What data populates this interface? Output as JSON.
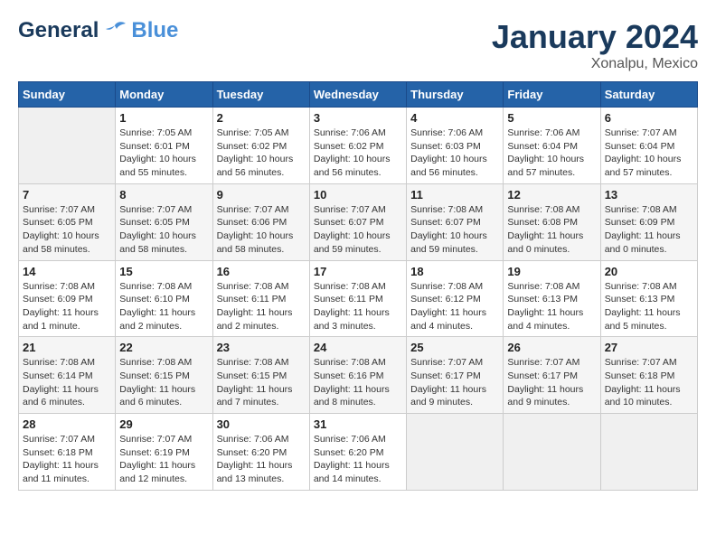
{
  "header": {
    "logo_general": "General",
    "logo_blue": "Blue",
    "month_title": "January 2024",
    "location": "Xonalpu, Mexico"
  },
  "weekdays": [
    "Sunday",
    "Monday",
    "Tuesday",
    "Wednesday",
    "Thursday",
    "Friday",
    "Saturday"
  ],
  "weeks": [
    [
      {
        "day": "",
        "info": ""
      },
      {
        "day": "1",
        "info": "Sunrise: 7:05 AM\nSunset: 6:01 PM\nDaylight: 10 hours\nand 55 minutes."
      },
      {
        "day": "2",
        "info": "Sunrise: 7:05 AM\nSunset: 6:02 PM\nDaylight: 10 hours\nand 56 minutes."
      },
      {
        "day": "3",
        "info": "Sunrise: 7:06 AM\nSunset: 6:02 PM\nDaylight: 10 hours\nand 56 minutes."
      },
      {
        "day": "4",
        "info": "Sunrise: 7:06 AM\nSunset: 6:03 PM\nDaylight: 10 hours\nand 56 minutes."
      },
      {
        "day": "5",
        "info": "Sunrise: 7:06 AM\nSunset: 6:04 PM\nDaylight: 10 hours\nand 57 minutes."
      },
      {
        "day": "6",
        "info": "Sunrise: 7:07 AM\nSunset: 6:04 PM\nDaylight: 10 hours\nand 57 minutes."
      }
    ],
    [
      {
        "day": "7",
        "info": "Sunrise: 7:07 AM\nSunset: 6:05 PM\nDaylight: 10 hours\nand 58 minutes."
      },
      {
        "day": "8",
        "info": "Sunrise: 7:07 AM\nSunset: 6:05 PM\nDaylight: 10 hours\nand 58 minutes."
      },
      {
        "day": "9",
        "info": "Sunrise: 7:07 AM\nSunset: 6:06 PM\nDaylight: 10 hours\nand 58 minutes."
      },
      {
        "day": "10",
        "info": "Sunrise: 7:07 AM\nSunset: 6:07 PM\nDaylight: 10 hours\nand 59 minutes."
      },
      {
        "day": "11",
        "info": "Sunrise: 7:08 AM\nSunset: 6:07 PM\nDaylight: 10 hours\nand 59 minutes."
      },
      {
        "day": "12",
        "info": "Sunrise: 7:08 AM\nSunset: 6:08 PM\nDaylight: 11 hours\nand 0 minutes."
      },
      {
        "day": "13",
        "info": "Sunrise: 7:08 AM\nSunset: 6:09 PM\nDaylight: 11 hours\nand 0 minutes."
      }
    ],
    [
      {
        "day": "14",
        "info": "Sunrise: 7:08 AM\nSunset: 6:09 PM\nDaylight: 11 hours\nand 1 minute."
      },
      {
        "day": "15",
        "info": "Sunrise: 7:08 AM\nSunset: 6:10 PM\nDaylight: 11 hours\nand 2 minutes."
      },
      {
        "day": "16",
        "info": "Sunrise: 7:08 AM\nSunset: 6:11 PM\nDaylight: 11 hours\nand 2 minutes."
      },
      {
        "day": "17",
        "info": "Sunrise: 7:08 AM\nSunset: 6:11 PM\nDaylight: 11 hours\nand 3 minutes."
      },
      {
        "day": "18",
        "info": "Sunrise: 7:08 AM\nSunset: 6:12 PM\nDaylight: 11 hours\nand 4 minutes."
      },
      {
        "day": "19",
        "info": "Sunrise: 7:08 AM\nSunset: 6:13 PM\nDaylight: 11 hours\nand 4 minutes."
      },
      {
        "day": "20",
        "info": "Sunrise: 7:08 AM\nSunset: 6:13 PM\nDaylight: 11 hours\nand 5 minutes."
      }
    ],
    [
      {
        "day": "21",
        "info": "Sunrise: 7:08 AM\nSunset: 6:14 PM\nDaylight: 11 hours\nand 6 minutes."
      },
      {
        "day": "22",
        "info": "Sunrise: 7:08 AM\nSunset: 6:15 PM\nDaylight: 11 hours\nand 6 minutes."
      },
      {
        "day": "23",
        "info": "Sunrise: 7:08 AM\nSunset: 6:15 PM\nDaylight: 11 hours\nand 7 minutes."
      },
      {
        "day": "24",
        "info": "Sunrise: 7:08 AM\nSunset: 6:16 PM\nDaylight: 11 hours\nand 8 minutes."
      },
      {
        "day": "25",
        "info": "Sunrise: 7:07 AM\nSunset: 6:17 PM\nDaylight: 11 hours\nand 9 minutes."
      },
      {
        "day": "26",
        "info": "Sunrise: 7:07 AM\nSunset: 6:17 PM\nDaylight: 11 hours\nand 9 minutes."
      },
      {
        "day": "27",
        "info": "Sunrise: 7:07 AM\nSunset: 6:18 PM\nDaylight: 11 hours\nand 10 minutes."
      }
    ],
    [
      {
        "day": "28",
        "info": "Sunrise: 7:07 AM\nSunset: 6:18 PM\nDaylight: 11 hours\nand 11 minutes."
      },
      {
        "day": "29",
        "info": "Sunrise: 7:07 AM\nSunset: 6:19 PM\nDaylight: 11 hours\nand 12 minutes."
      },
      {
        "day": "30",
        "info": "Sunrise: 7:06 AM\nSunset: 6:20 PM\nDaylight: 11 hours\nand 13 minutes."
      },
      {
        "day": "31",
        "info": "Sunrise: 7:06 AM\nSunset: 6:20 PM\nDaylight: 11 hours\nand 14 minutes."
      },
      {
        "day": "",
        "info": ""
      },
      {
        "day": "",
        "info": ""
      },
      {
        "day": "",
        "info": ""
      }
    ]
  ]
}
